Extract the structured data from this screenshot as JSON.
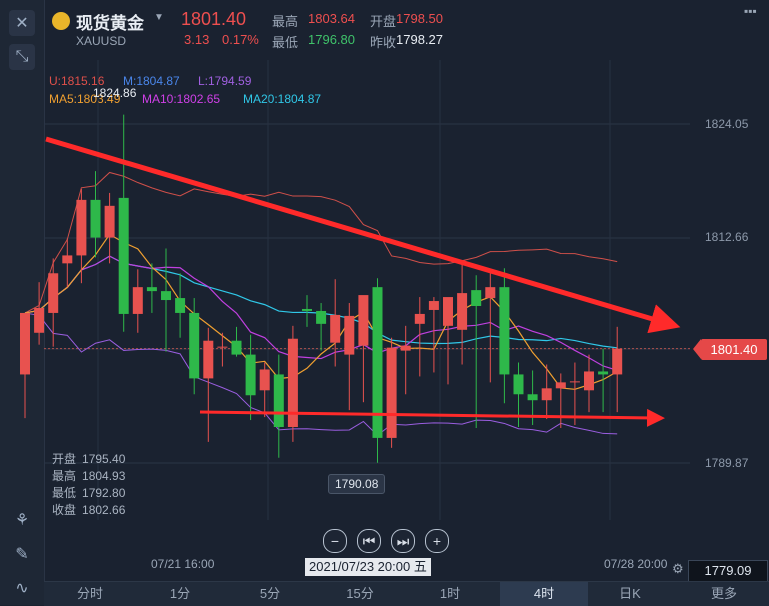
{
  "header": {
    "title": "现货黄金",
    "symbol": "XAUUSD",
    "price": "1801.40",
    "change": "3.13",
    "change_pct": "0.17%",
    "high_label": "最高",
    "high": "1803.64",
    "open_label": "开盘",
    "open": "1798.50",
    "low_label": "最低",
    "low": "1796.80",
    "prev_close_label": "昨收",
    "prev_close": "1798.27"
  },
  "indicators": {
    "boll_u": "U:1815.16",
    "boll_m": "M:1804.87",
    "boll_l": "L:1794.59",
    "ma5": "MA5:1803.49",
    "ma10": "MA10:1802.65",
    "ma20": "MA20:1804.87"
  },
  "annotations": {
    "high_marker": "1824.86",
    "low_marker": "1790.08",
    "current_price_tag": "1801.40",
    "bottom_price": "1779.09",
    "cursor_date": "2021/07/23 20:00 五"
  },
  "ohlc_panel": {
    "open_label": "开盘",
    "open": "1795.40",
    "high_label": "最高",
    "high": "1804.93",
    "low_label": "最低",
    "low": "1792.80",
    "close_label": "收盘",
    "close": "1802.66"
  },
  "time_labels": [
    "07/21 16:00",
    "07/28 20:00"
  ],
  "timeframes": [
    "分时",
    "1分",
    "5分",
    "15分",
    "1时",
    "4时",
    "日K",
    "更多"
  ],
  "active_timeframe": "4时",
  "colors": {
    "up": "#e8524f",
    "down": "#2eb84a",
    "ma5": "#f0a030",
    "ma10": "#c040e0",
    "ma20": "#30c8e8",
    "boll": "#a060e0",
    "trend": "#ff2a2a"
  },
  "chart_data": {
    "type": "candlestick",
    "ylim": [
      1779.09,
      1827.8
    ],
    "y_ticks": [
      1824.05,
      1812.66,
      1801.4,
      1789.87
    ],
    "candles": [
      {
        "o": 1798.8,
        "h": 1805.0,
        "l": 1794.4,
        "c": 1805.0
      },
      {
        "o": 1803.0,
        "h": 1808.1,
        "l": 1801.8,
        "c": 1805.5
      },
      {
        "o": 1805.0,
        "h": 1810.5,
        "l": 1801.6,
        "c": 1809.0
      },
      {
        "o": 1810.0,
        "h": 1812.5,
        "l": 1807.6,
        "c": 1810.8
      },
      {
        "o": 1810.8,
        "h": 1817.5,
        "l": 1808.0,
        "c": 1816.4
      },
      {
        "o": 1816.4,
        "h": 1819.3,
        "l": 1810.6,
        "c": 1812.6
      },
      {
        "o": 1812.6,
        "h": 1817.1,
        "l": 1810.0,
        "c": 1815.8
      },
      {
        "o": 1816.6,
        "h": 1825.0,
        "l": 1803.1,
        "c": 1804.9
      },
      {
        "o": 1804.9,
        "h": 1809.4,
        "l": 1803.0,
        "c": 1807.6
      },
      {
        "o": 1807.6,
        "h": 1810.0,
        "l": 1805.0,
        "c": 1807.2
      },
      {
        "o": 1807.2,
        "h": 1811.5,
        "l": 1801.1,
        "c": 1806.3
      },
      {
        "o": 1806.5,
        "h": 1809.0,
        "l": 1802.5,
        "c": 1805.0
      },
      {
        "o": 1805.0,
        "h": 1806.5,
        "l": 1796.8,
        "c": 1798.4
      },
      {
        "o": 1798.4,
        "h": 1803.5,
        "l": 1792.0,
        "c": 1802.2
      },
      {
        "o": 1801.6,
        "h": 1803.0,
        "l": 1799.6,
        "c": 1801.6
      },
      {
        "o": 1802.2,
        "h": 1803.6,
        "l": 1800.6,
        "c": 1800.8
      },
      {
        "o": 1800.8,
        "h": 1802.8,
        "l": 1794.2,
        "c": 1796.7
      },
      {
        "o": 1797.2,
        "h": 1800.0,
        "l": 1794.5,
        "c": 1799.3
      },
      {
        "o": 1798.8,
        "h": 1800.8,
        "l": 1790.4,
        "c": 1793.5
      },
      {
        "o": 1793.5,
        "h": 1803.7,
        "l": 1792.0,
        "c": 1802.4
      },
      {
        "o": 1805.4,
        "h": 1806.8,
        "l": 1803.6,
        "c": 1805.2
      },
      {
        "o": 1805.2,
        "h": 1806.0,
        "l": 1801.2,
        "c": 1803.9
      },
      {
        "o": 1802.0,
        "h": 1808.4,
        "l": 1799.6,
        "c": 1804.8
      },
      {
        "o": 1800.8,
        "h": 1806.0,
        "l": 1795.2,
        "c": 1804.7
      },
      {
        "o": 1801.7,
        "h": 1805.9,
        "l": 1796.0,
        "c": 1806.8
      },
      {
        "o": 1807.6,
        "h": 1808.5,
        "l": 1789.9,
        "c": 1792.4
      },
      {
        "o": 1792.4,
        "h": 1802.5,
        "l": 1791.4,
        "c": 1801.5
      },
      {
        "o": 1801.2,
        "h": 1803.7,
        "l": 1796.8,
        "c": 1801.7
      },
      {
        "o": 1803.9,
        "h": 1806.6,
        "l": 1798.6,
        "c": 1804.9
      },
      {
        "o": 1805.3,
        "h": 1806.6,
        "l": 1799.0,
        "c": 1806.2
      },
      {
        "o": 1803.7,
        "h": 1805.4,
        "l": 1797.8,
        "c": 1806.6
      },
      {
        "o": 1803.3,
        "h": 1810.2,
        "l": 1799.8,
        "c": 1807.0
      },
      {
        "o": 1807.3,
        "h": 1808.8,
        "l": 1793.4,
        "c": 1805.7
      },
      {
        "o": 1806.5,
        "h": 1809.0,
        "l": 1798.0,
        "c": 1807.6
      },
      {
        "o": 1807.6,
        "h": 1809.5,
        "l": 1795.9,
        "c": 1798.8
      },
      {
        "o": 1798.8,
        "h": 1800.0,
        "l": 1793.5,
        "c": 1796.8
      },
      {
        "o": 1796.8,
        "h": 1799.2,
        "l": 1793.7,
        "c": 1796.2
      },
      {
        "o": 1796.2,
        "h": 1799.8,
        "l": 1794.3,
        "c": 1797.4
      },
      {
        "o": 1797.4,
        "h": 1798.9,
        "l": 1793.4,
        "c": 1798.0
      },
      {
        "o": 1798.0,
        "h": 1800.0,
        "l": 1793.7,
        "c": 1798.1
      },
      {
        "o": 1797.2,
        "h": 1800.8,
        "l": 1795.0,
        "c": 1799.1
      },
      {
        "o": 1799.1,
        "h": 1801.4,
        "l": 1795.0,
        "c": 1798.8
      },
      {
        "o": 1798.8,
        "h": 1803.6,
        "l": 1795.0,
        "c": 1801.4
      }
    ]
  }
}
